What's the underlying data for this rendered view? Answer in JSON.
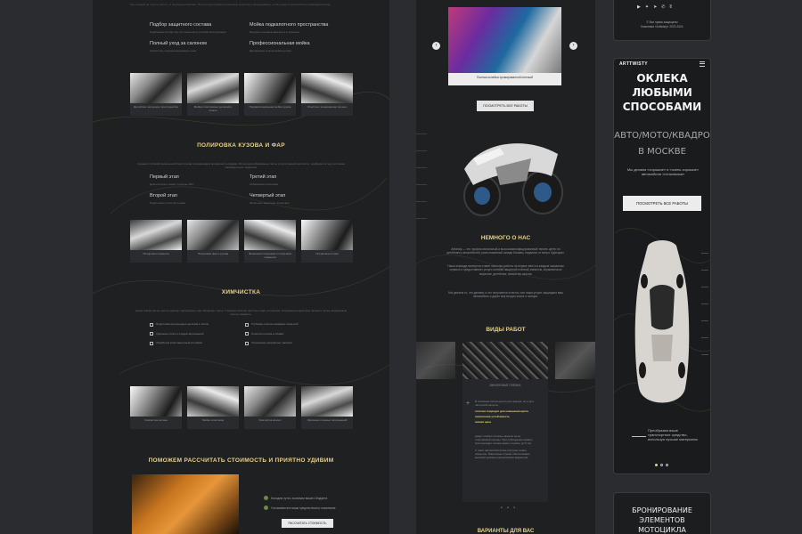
{
  "left": {
    "top_note": "Мы создаем не просто чистоту, а ощущение новизны. Используем профессиональные средства и оборудование, чтобы вернуть автомобилю первозданный вид.",
    "detail_services": [
      {
        "title": "Подбор защитного состава",
        "desc": "Подбираем состав под тип покрытия и условия эксплуатации"
      },
      {
        "title": "Мойка подкапотного пространства",
        "desc": "Бережно очищаем двигатель и агрегаты"
      },
      {
        "title": "Полный уход за салоном",
        "desc": "Химчистка, кондиционирование кожи"
      },
      {
        "title": "Профессиональная мойка",
        "desc": "Двухфазная ручная мойка кузова"
      }
    ],
    "thumbs1": [
      "Детейлинг моторного пространства",
      "Мойка пластиковых деталей и стекол",
      "Профессиональная мойка кузова",
      "Очистка и кондиционер салона"
    ],
    "polish_title": "ПОЛИРОВКА КУЗОВА И ФАР",
    "polish_para": "Создаем глубокий зеркальный блеск кузова и возвращаем прозрачность фарам. Используем абразивные пасты и круги разной жесткости, подбирая их под состояние лакокрасочного покрытия.",
    "polish_steps": [
      {
        "title": "Первый этап",
        "desc": "Диагностика и замер толщины ЛКП"
      },
      {
        "title": "Третий этап",
        "desc": "Абразивная полировка"
      },
      {
        "title": "Второй этап",
        "desc": "Подготовка и очистка кузова"
      },
      {
        "title": "Четвертый этап",
        "desc": "Финишная защитная полировка"
      }
    ],
    "thumbs2": [
      "Полировка элемента",
      "Полировка фар и кузова",
      "Финишная полировка и полировка элемента",
      "Полировка оптики"
    ],
    "clean_title": "ХИМЧИСТКА",
    "clean_para": "Наша химчистка не просто удаляет загрязнения, она обновляет салон. Глубокая очистка текстиля, кожи и пластика. Устраняем неприятные запахи и пятна, возвращаем салону свежесть.",
    "clean_items": [
      "Подготовка интерьерных деталей к чистке",
      "Глубокая очистка ковровых покрытий",
      "Удаление пятен и следов загрязнений",
      "Очистка потолка и обивки",
      "Обработка кожи защитным составом",
      "Устранение неприятных запахов"
    ],
    "thumbs3": [
      "Химчистка салона",
      "Мойка пластиков",
      "Химчистка кресел",
      "Удаление сложных загрязнений"
    ],
    "cost_title": "ПОМОЖЕМ РАССЧИТАТЬ СТОИМОСТЬ И ПРИЯТНО УДИВИМ",
    "cost_bullets": [
      "Находим пути к экономии вашего бюджета",
      "Учитываем все ваши предпочтения и пожелания"
    ],
    "cost_button": "РАССЧИТАТЬ СТОИМОСТЬ"
  },
  "mid": {
    "slider_caption": "Полная оклейка хромированной пленкой",
    "slider_prev": "‹",
    "slider_next": "›",
    "view_all_button": "ПОСМОТРЕТЬ ВСЕ РАБОТЫ",
    "about_title": "НЕМНОГО О НАС",
    "about_para1": "Arttwisty — это профессиональный и высококвалифицированный тюнинг-центр по детейлингу автомобилей, расположенный западе Москвы, недалеко от метро Одинцово.",
    "about_para2": "Наша команда экспертов ставит качество работы на первое место в каждом оказанном сервисе и предоставляет услуги оклейки защитной пленкой, винилом, керамическое покрытие, детейлинг, химчистку салона.",
    "about_para3": "Мы делаем то, что делаем, и это получается отлично, все наши услуги защищают ваш автомобиль и дарят ему вторую жизнь и эмоции.",
    "works_title": "ВИДЫ РАБОТ",
    "works_label": "ВИНИЛОВАЯ ПЛЕНКА",
    "works_text1": "В основном используется для декора, но и для частичной защиты.",
    "works_hl": [
      "отлично подходит для изменения цвета",
      "химическая устойчивость",
      "низкая цена"
    ],
    "works_text2": "имеет слабую степень защиты из-за пластиковой основы. При соблюдении правил эксплуатации пленка может служить до 5 лет.",
    "works_text3": "У таких автомобилей вид получает новое покрытие. Виниловые пленки обеспечивают высокий уровень разнообразия вариантов.",
    "bottom_title": "ВАРИАНТЫ ДЛЯ ВАС",
    "carousel_dots": "• • •"
  },
  "right": {
    "copyright_lines": [
      "© Все права защищены",
      "Компания «Arttwisty» 2023-2024"
    ],
    "logo": "ARTTWISTY",
    "hero_title_lines": [
      "ОКЛЕКА",
      "ЛЮБЫМИ",
      "СПОСОБАМИ"
    ],
    "hero_sub_lines": [
      "АВТО/МОТО/КВАДРО",
      "В МОСКВЕ"
    ],
    "hero_tagline": "Мы делаем «хорошие» и «очень хорошие» автомобили «отличными»",
    "hero_button": "ПОСМОТРЕТЬ ВСЕ РАБОТЫ",
    "car_caption": "Преобразим ваше транспортное средство, используя лучшие материалы",
    "booking_title_lines": [
      "БРОНИРОВАНИЕ",
      "ЭЛЕМЕНТОВ",
      "МОТОЦИКЛА"
    ]
  },
  "colors": {
    "accent_gold": "#e8d28a",
    "page_bg": "#1f2022",
    "canvas_bg": "#2b2c2f"
  }
}
